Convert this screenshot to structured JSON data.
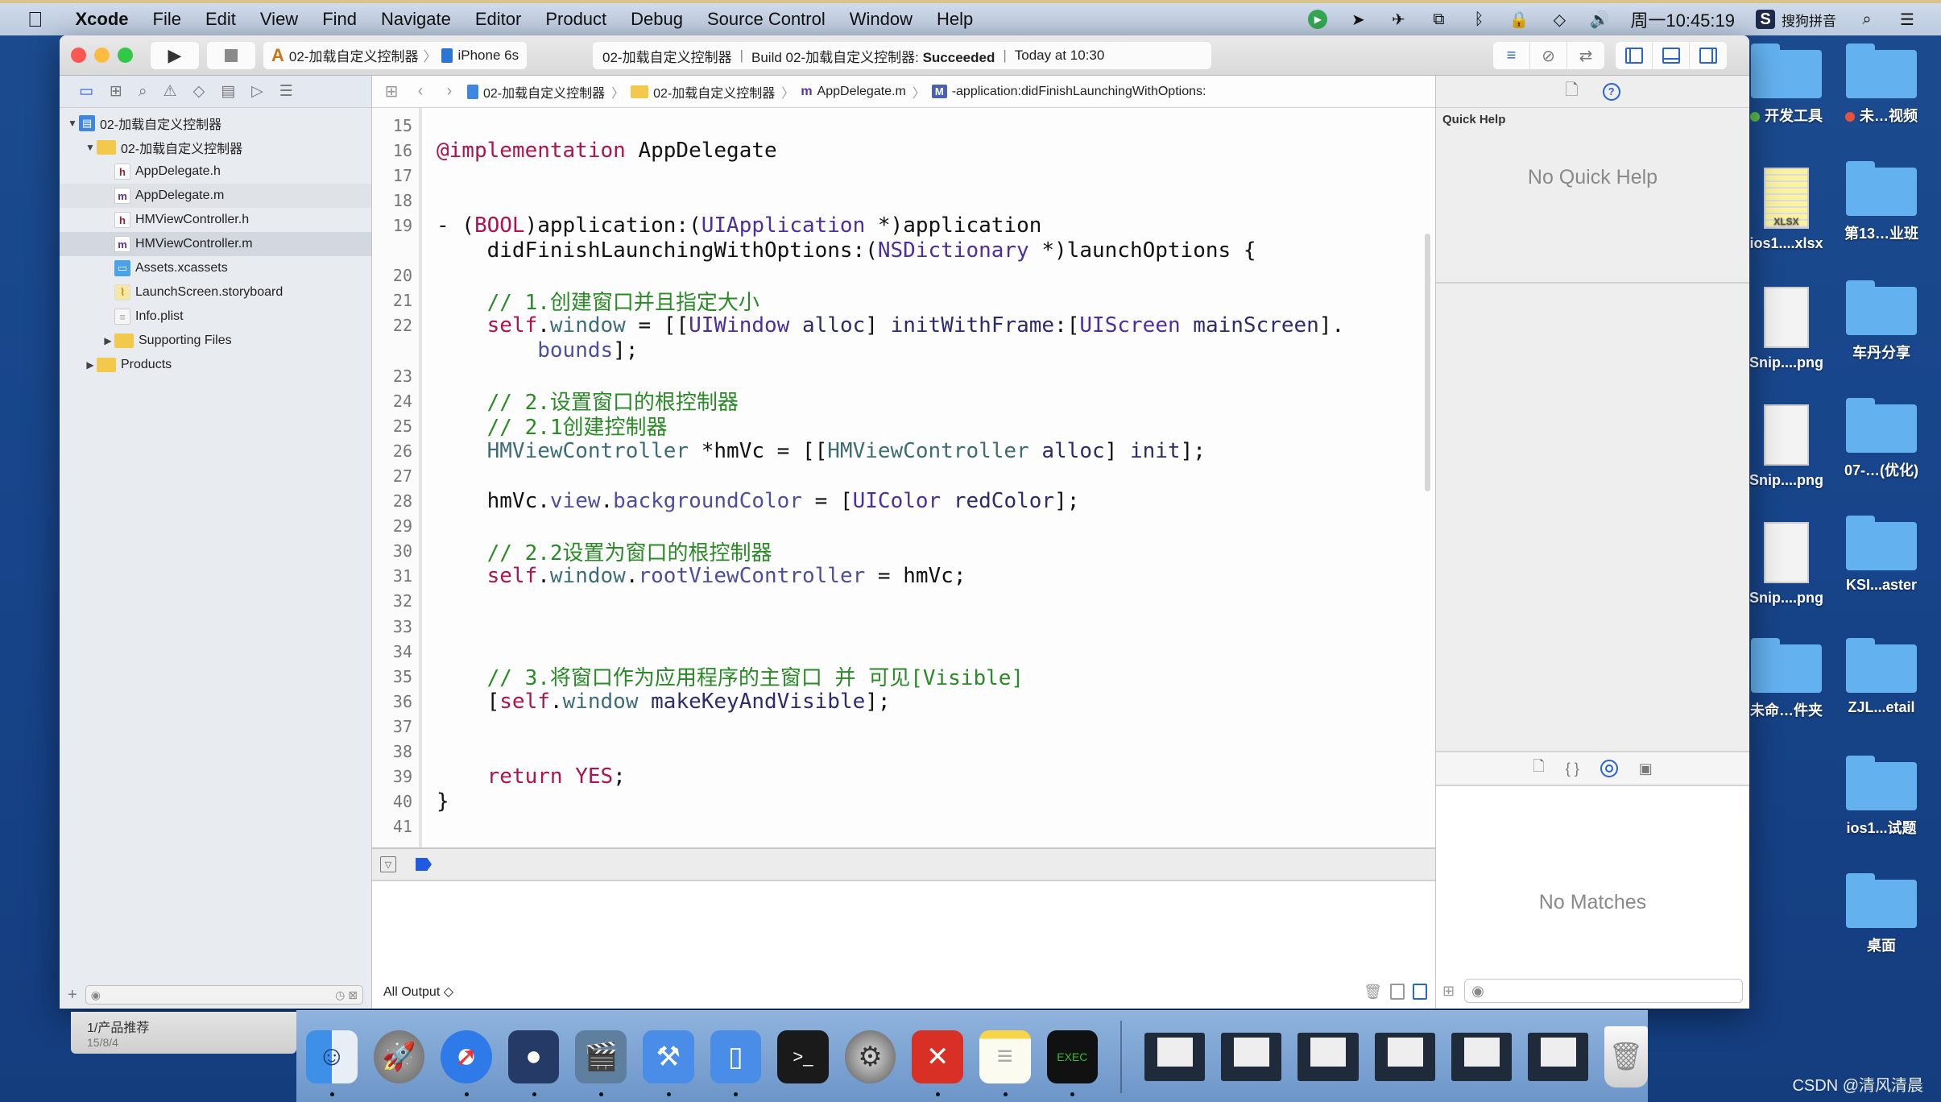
{
  "menubar": {
    "apple_icon": "apple-logo-icon",
    "app_name": "Xcode",
    "items": [
      "File",
      "Edit",
      "View",
      "Find",
      "Navigate",
      "Editor",
      "Product",
      "Debug",
      "Source Control",
      "Window",
      "Help"
    ],
    "status_icons": [
      "record-icon",
      "location-icon",
      "airplane-icon",
      "screen-record-icon",
      "bluetooth-icon",
      "lock-icon",
      "wifi-icon",
      "volume-icon"
    ],
    "clock": "周一10:45:19",
    "input_method": "搜狗拼音",
    "input_method_badge": "S",
    "search_icon": "⌕",
    "list_icon": "☰"
  },
  "toolbar": {
    "run_icon": "▶",
    "scheme_name": "02-加载自定义控制器",
    "device": "iPhone 6s",
    "activity": {
      "project": "02-加载自定义控制器",
      "build_prefix": "Build 02-加载自定义控制器:",
      "build_status": "Succeeded",
      "time": "Today at 10:30"
    }
  },
  "navigator": {
    "tabs": [
      "project-navigator",
      "symbol-navigator",
      "find-navigator",
      "issue-navigator",
      "test-navigator",
      "debug-navigator",
      "breakpoint-navigator",
      "report-navigator"
    ],
    "tab_glyphs": [
      "▭",
      "⊞",
      "⌕",
      "⚠",
      "◇",
      "▤",
      "▷",
      "☰"
    ],
    "tree": [
      {
        "label": "02-加载自定义控制器",
        "type": "project",
        "indent": 0,
        "expanded": true
      },
      {
        "label": "02-加载自定义控制器",
        "type": "folder",
        "indent": 1,
        "expanded": true
      },
      {
        "label": "AppDelegate.h",
        "type": "h",
        "indent": 2
      },
      {
        "label": "AppDelegate.m",
        "type": "m",
        "indent": 2,
        "state": "hover"
      },
      {
        "label": "HMViewController.h",
        "type": "h",
        "indent": 2
      },
      {
        "label": "HMViewController.m",
        "type": "m",
        "indent": 2,
        "state": "selected"
      },
      {
        "label": "Assets.xcassets",
        "type": "assets",
        "indent": 2
      },
      {
        "label": "LaunchScreen.storyboard",
        "type": "storyboard",
        "indent": 2
      },
      {
        "label": "Info.plist",
        "type": "plist",
        "indent": 2
      },
      {
        "label": "Supporting Files",
        "type": "folder",
        "indent": 2,
        "expanded": false
      },
      {
        "label": "Products",
        "type": "folder",
        "indent": 1,
        "expanded": false
      }
    ],
    "add_label": "+"
  },
  "jumpbar": {
    "crumbs": [
      "02-加载自定义控制器",
      "02-加载自定义控制器",
      "AppDelegate.m",
      "-application:didFinishLaunchingWithOptions:"
    ]
  },
  "editor": {
    "lines": [
      {
        "n": "15",
        "html": ""
      },
      {
        "n": "16",
        "html": "<span class='kw'>@implementation</span> AppDelegate"
      },
      {
        "n": "17",
        "html": ""
      },
      {
        "n": "18",
        "html": ""
      },
      {
        "n": "19",
        "html": "- (<span class='kw'>BOOL</span>)application:(<span class='ty'>UIApplication</span> *)application"
      },
      {
        "n": "",
        "html": "    didFinishLaunchingWithOptions:(<span class='ty'>NSDictionary</span> *)launchOptions {"
      },
      {
        "n": "20",
        "html": ""
      },
      {
        "n": "21",
        "html": "    <span class='cm'>// 1.创建窗口并且指定大小</span>"
      },
      {
        "n": "22",
        "html": "    <span class='kw'>self</span>.<span class='tyc'>window</span> = [[<span class='ty'>UIWindow</span> <span class='mt'>alloc</span>] <span class='mt'>initWithFrame</span>:[<span class='ty'>UIScreen</span> <span class='mt'>mainScreen</span>]."
      },
      {
        "n": "",
        "html": "        <span class='pr'>bounds</span>];"
      },
      {
        "n": "23",
        "html": ""
      },
      {
        "n": "24",
        "html": "    <span class='cm'>// 2.设置窗口的根控制器</span>"
      },
      {
        "n": "25",
        "html": "    <span class='cm'>// 2.1创建控制器</span>"
      },
      {
        "n": "26",
        "html": "    <span class='tyc'>HMViewController</span> *hmVc = [[<span class='tyc'>HMViewController</span> <span class='mt'>alloc</span>] <span class='mt'>init</span>];"
      },
      {
        "n": "27",
        "html": ""
      },
      {
        "n": "28",
        "html": "    hmVc.<span class='pr'>view</span>.<span class='pr'>backgroundColor</span> = [<span class='ty'>UIColor</span> <span class='mt'>redColor</span>];"
      },
      {
        "n": "29",
        "html": ""
      },
      {
        "n": "30",
        "html": "    <span class='cm'>// 2.2设置为窗口的根控制器</span>"
      },
      {
        "n": "31",
        "html": "    <span class='kw'>self</span>.<span class='tyc'>window</span>.<span class='pr'>rootViewController</span> = hmVc;"
      },
      {
        "n": "32",
        "html": ""
      },
      {
        "n": "33",
        "html": ""
      },
      {
        "n": "34",
        "html": ""
      },
      {
        "n": "35",
        "html": "    <span class='cm'>// 3.将窗口作为应用程序的主窗口 并 可见[Visible]</span>"
      },
      {
        "n": "36",
        "html": "    [<span class='kw'>self</span>.<span class='tyc'>window</span> <span class='mt'>makeKeyAndVisible</span>];"
      },
      {
        "n": "37",
        "html": ""
      },
      {
        "n": "38",
        "html": ""
      },
      {
        "n": "39",
        "html": "    <span class='kw'>return</span> <span class='kw'>YES</span>;"
      },
      {
        "n": "40",
        "html": "}"
      },
      {
        "n": "41",
        "html": ""
      }
    ]
  },
  "debug": {
    "output_selector": "All Output ◇"
  },
  "utilities": {
    "quick_help_title": "Quick Help",
    "quick_help_empty": "No Quick Help",
    "library_empty": "No Matches"
  },
  "desktop": {
    "items": [
      {
        "label": "开发工具",
        "kind": "folder",
        "tag": "#5bbf4a"
      },
      {
        "label": "未…视频",
        "kind": "folder",
        "tag": "#e8523a"
      },
      {
        "label": "ios1....xlsx",
        "kind": "xlsx",
        "badge": "XLSX"
      },
      {
        "label": "第13…业班",
        "kind": "folder"
      },
      {
        "label": "Snip....png",
        "kind": "doc"
      },
      {
        "label": "车丹分享",
        "kind": "folder"
      },
      {
        "label": "Snip....png",
        "kind": "doc"
      },
      {
        "label": "07-…(优化)",
        "kind": "folder"
      },
      {
        "label": "Snip....png",
        "kind": "doc"
      },
      {
        "label": "KSI...aster",
        "kind": "folder"
      },
      {
        "label": "未命…件夹",
        "kind": "folder"
      },
      {
        "label": "ZJL...etail",
        "kind": "folder"
      },
      {
        "label": "ios1...试题",
        "kind": "folder"
      },
      {
        "label": "桌面",
        "kind": "folder"
      }
    ]
  },
  "notification": {
    "title": "1/产品推荐",
    "date": "15/8/4"
  },
  "dock": {
    "apps": [
      {
        "name": "finder",
        "glyph": "☺",
        "running": true
      },
      {
        "name": "launchpad",
        "glyph": "🚀",
        "running": false
      },
      {
        "name": "safari",
        "glyph": "➚",
        "running": true
      },
      {
        "name": "mouse-app",
        "glyph": "●",
        "running": true
      },
      {
        "name": "video-app",
        "glyph": "🎬",
        "running": true
      },
      {
        "name": "xcode",
        "glyph": "⚒",
        "running": true
      },
      {
        "name": "simulator",
        "glyph": "▯",
        "running": true
      },
      {
        "name": "terminal",
        "glyph": ">_",
        "running": false
      },
      {
        "name": "system-preferences",
        "glyph": "⚙",
        "running": false
      },
      {
        "name": "xmind",
        "glyph": "✕",
        "running": true
      },
      {
        "name": "notes",
        "glyph": "≡",
        "running": true
      },
      {
        "name": "console",
        "glyph": "EXEC",
        "running": true
      }
    ],
    "windows": 6,
    "trash_glyph": "🗑"
  },
  "watermark": "CSDN @清风清晨"
}
